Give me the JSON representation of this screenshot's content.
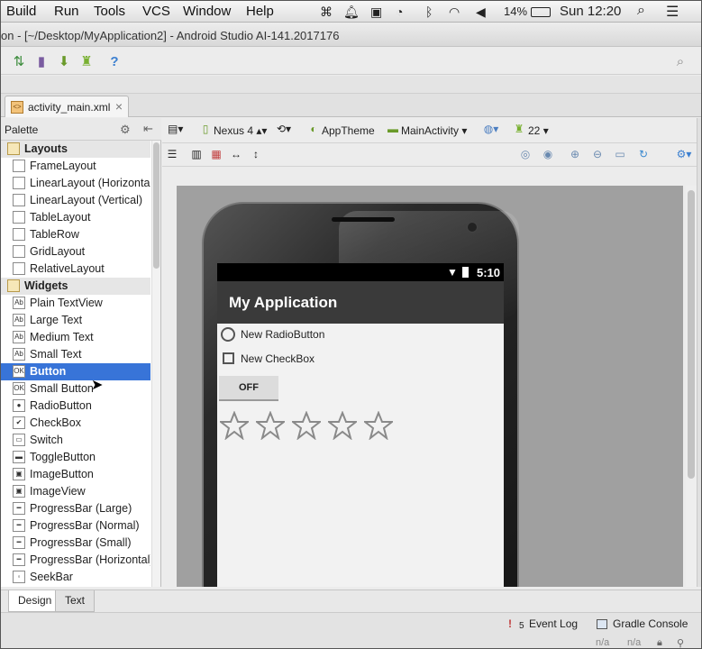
{
  "menubar": {
    "items": [
      "Build",
      "Run",
      "Tools",
      "VCS",
      "Window",
      "Help"
    ],
    "battery": "14%",
    "clock": "Sun 12:20"
  },
  "window": {
    "title": "on - [~/Desktop/MyApplication2] - Android Studio AI-141.2017176"
  },
  "editor_tab": {
    "file_name": "activity_main.xml",
    "close_glyph": "×"
  },
  "palette": {
    "title": "Palette",
    "items": [
      {
        "label": "Layouts",
        "category": true,
        "icon": "folder-icon"
      },
      {
        "label": "FrameLayout",
        "icon": "frame-layout-icon"
      },
      {
        "label": "LinearLayout (Horizontal)",
        "icon": "linear-horizontal-icon"
      },
      {
        "label": "LinearLayout (Vertical)",
        "icon": "linear-vertical-icon"
      },
      {
        "label": "TableLayout",
        "icon": "table-layout-icon"
      },
      {
        "label": "TableRow",
        "icon": "table-row-icon"
      },
      {
        "label": "GridLayout",
        "icon": "grid-layout-icon"
      },
      {
        "label": "RelativeLayout",
        "icon": "relative-layout-icon"
      },
      {
        "label": "Widgets",
        "category": true,
        "icon": "folder-icon"
      },
      {
        "label": "Plain TextView",
        "icon": "text-icon",
        "glyph": "Ab"
      },
      {
        "label": "Large Text",
        "icon": "text-icon",
        "glyph": "Ab"
      },
      {
        "label": "Medium Text",
        "icon": "text-icon",
        "glyph": "Ab"
      },
      {
        "label": "Small Text",
        "icon": "text-icon",
        "glyph": "Ab"
      },
      {
        "label": "Button",
        "icon": "button-icon",
        "glyph": "OK",
        "selected": true
      },
      {
        "label": "Small Button",
        "icon": "button-icon",
        "glyph": "OK"
      },
      {
        "label": "RadioButton",
        "icon": "radio-icon",
        "glyph": "●"
      },
      {
        "label": "CheckBox",
        "icon": "checkbox-icon",
        "glyph": "✔"
      },
      {
        "label": "Switch",
        "icon": "switch-icon",
        "glyph": "▭"
      },
      {
        "label": "ToggleButton",
        "icon": "toggle-icon",
        "glyph": "▬"
      },
      {
        "label": "ImageButton",
        "icon": "image-button-icon",
        "glyph": "▣"
      },
      {
        "label": "ImageView",
        "icon": "image-view-icon",
        "glyph": "▣"
      },
      {
        "label": "ProgressBar (Large)",
        "icon": "progressbar-icon",
        "glyph": "━"
      },
      {
        "label": "ProgressBar (Normal)",
        "icon": "progressbar-icon",
        "glyph": "━"
      },
      {
        "label": "ProgressBar (Small)",
        "icon": "progressbar-icon",
        "glyph": "━"
      },
      {
        "label": "ProgressBar (Horizontal)",
        "icon": "progressbar-icon",
        "glyph": "━"
      },
      {
        "label": "SeekBar",
        "icon": "seekbar-icon",
        "glyph": "◦"
      }
    ]
  },
  "designer": {
    "device": "Nexus 4",
    "theme": "AppTheme",
    "activity": "MainActivity",
    "api_level": "22"
  },
  "preview": {
    "status_time": "5:10",
    "app_title": "My Application",
    "radio_label": "New RadioButton",
    "checkbox_label": "New CheckBox",
    "toggle_label": "OFF",
    "rating_stars_total": 5,
    "rating_stars_filled": 0
  },
  "bottom": {
    "tab_design": "Design",
    "tab_text": "Text",
    "event_log_count": "5",
    "event_log": "Event Log",
    "gradle_console": "Gradle Console",
    "status_na_1": "n/a",
    "status_na_2": "n/a"
  },
  "colors": {
    "selection": "#3874d8",
    "action_bar": "#3a3a3a",
    "canvas_bg": "#a0a0a0"
  }
}
